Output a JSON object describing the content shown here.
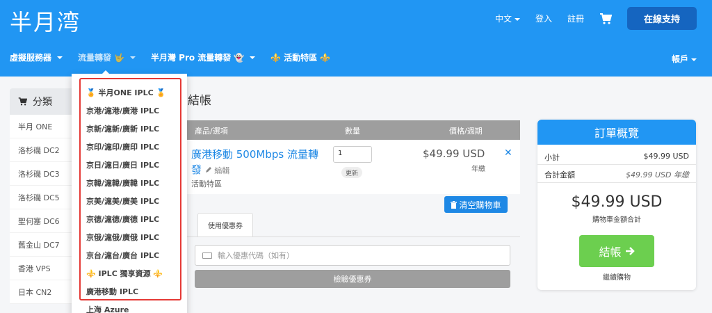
{
  "brand": {
    "logo": "半月湾"
  },
  "topbar": {
    "language": "中文",
    "login": "登入",
    "register": "註冊",
    "support_button": "在線支持"
  },
  "nav": {
    "items": [
      {
        "label": "虛擬服務器",
        "emoji": ""
      },
      {
        "label": "流量轉發",
        "emoji": "🤟"
      },
      {
        "label": "半月灣 Pro 流量轉發",
        "emoji": "👻"
      },
      {
        "label": "活動特區",
        "emoji": "⚜️",
        "emoji_after": "⚜️"
      }
    ],
    "account": "帳戶"
  },
  "sidebar": {
    "title": "分類",
    "items": [
      "半月 ONE",
      "洛杉磯 DC2",
      "洛杉磯 DC3",
      "洛杉磯 DC5",
      "聖何塞 DC6",
      "舊金山 DC7",
      "香港 VPS",
      "日本 CN2"
    ]
  },
  "dropdown": {
    "items": [
      "🏅 半月ONE IPLC 🏅",
      "京港/滬港/廣港 IPLC",
      "京新/滬新/廣新 IPLC",
      "京印/滬印/廣印 IPLC",
      "京日/滬日/廣日 IPLC",
      "京韓/滬韓/廣韓 IPLC",
      "京美/滬美/廣美 IPLC",
      "京德/滬德/廣德 IPLC",
      "京俄/滬俄/廣俄 IPLC",
      "京台/滬台/廣台 IPLC",
      "⚜️ IPLC 獨享資源 ⚜️",
      "廣港移動 IPLC",
      "上海 Azure"
    ]
  },
  "cart": {
    "page_title": "結帳",
    "columns": {
      "product": "產品/選項",
      "quantity": "數量",
      "price": "價格/週期"
    },
    "item": {
      "name": "廣港移動 500Mbps 流量轉發",
      "edit": "編輯",
      "group": "活動特區",
      "quantity": "1",
      "update": "更新",
      "price": "$49.99 USD",
      "cycle": "年繳"
    },
    "empty_cart": "清空購物車",
    "promo": {
      "tab": "使用優惠券",
      "placeholder": "輸入優惠代碼（如有）",
      "validate": "檢驗優惠券"
    }
  },
  "summary": {
    "title": "訂單概覽",
    "subtotal_label": "小計",
    "subtotal_value": "$49.99 USD",
    "totals_label": "合計金額",
    "totals_value": "$49.99 USD 年繳",
    "total_amount": "$49.99 USD",
    "total_caption": "購物車金額合計",
    "checkout": "結帳",
    "continue": "繼續購物"
  }
}
